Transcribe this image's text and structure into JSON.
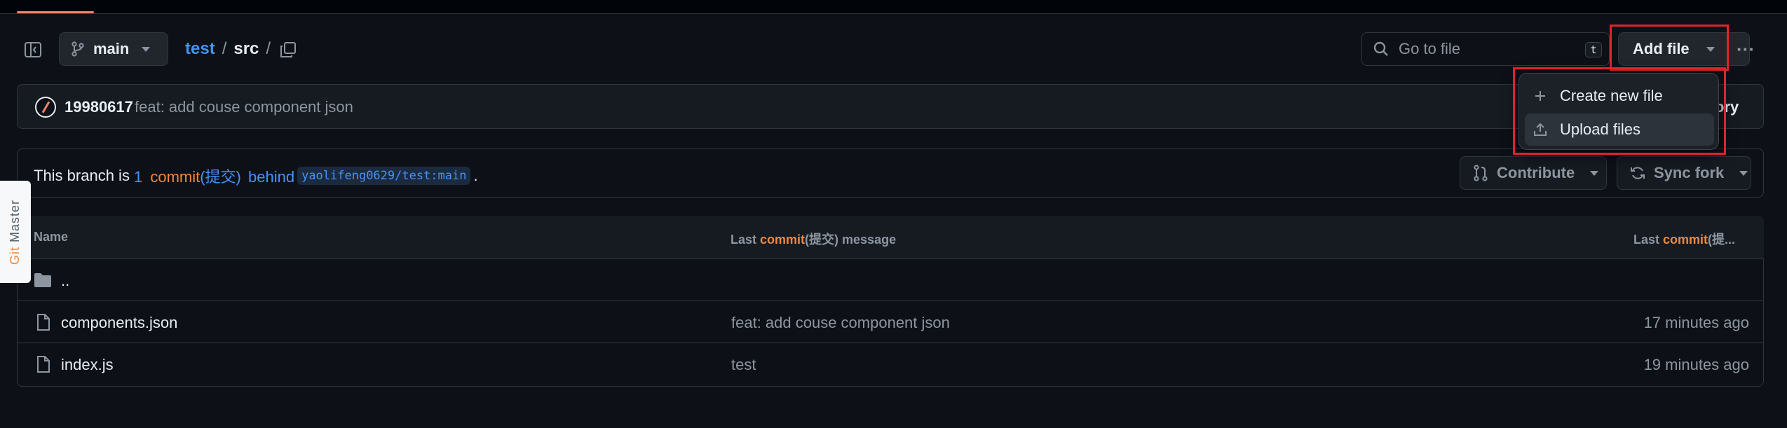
{
  "branch": {
    "name": "main"
  },
  "breadcrumb": {
    "repo": "test",
    "sep1": "/",
    "folder": "src",
    "sep2": "/"
  },
  "search": {
    "placeholder": "Go to file",
    "shortcut": "t"
  },
  "toolbar": {
    "add_file": "Add file",
    "more": "···"
  },
  "dropdown": {
    "items": [
      {
        "label": "Create new file",
        "icon": "plus-icon"
      },
      {
        "label": "Upload files",
        "icon": "upload-icon"
      }
    ]
  },
  "commit": {
    "author": "19980617",
    "message": "feat: add couse component json",
    "right_partial": "ory"
  },
  "branch_status": {
    "prefix": "This branch is",
    "count": "1",
    "commit_word": "commit",
    "commit_cn": "(提交)",
    "behind": "behind",
    "ref": "yaolifeng0629/test:main",
    "suffix": "."
  },
  "actions": {
    "contribute": "Contribute",
    "sync_fork": "Sync fork"
  },
  "table": {
    "headers": {
      "name": "Name",
      "msg_prefix": "Last",
      "msg_commit": "commit",
      "msg_suffix": "(提交) message",
      "date_prefix": "Last",
      "date_commit": "commit",
      "date_suffix": "(提..."
    },
    "rows": [
      {
        "name": "..",
        "message": "",
        "date": ""
      },
      {
        "name": "components.json",
        "message": "feat: add couse component json",
        "date": "17 minutes ago"
      },
      {
        "name": "index.js",
        "message": "test",
        "date": "19 minutes ago"
      }
    ]
  },
  "side_tab": {
    "part1": "Git ",
    "part2": "Master"
  },
  "colors": {
    "accent": "#4493f8",
    "highlight": "#e0232b",
    "commit_orange": "#f0883e"
  }
}
